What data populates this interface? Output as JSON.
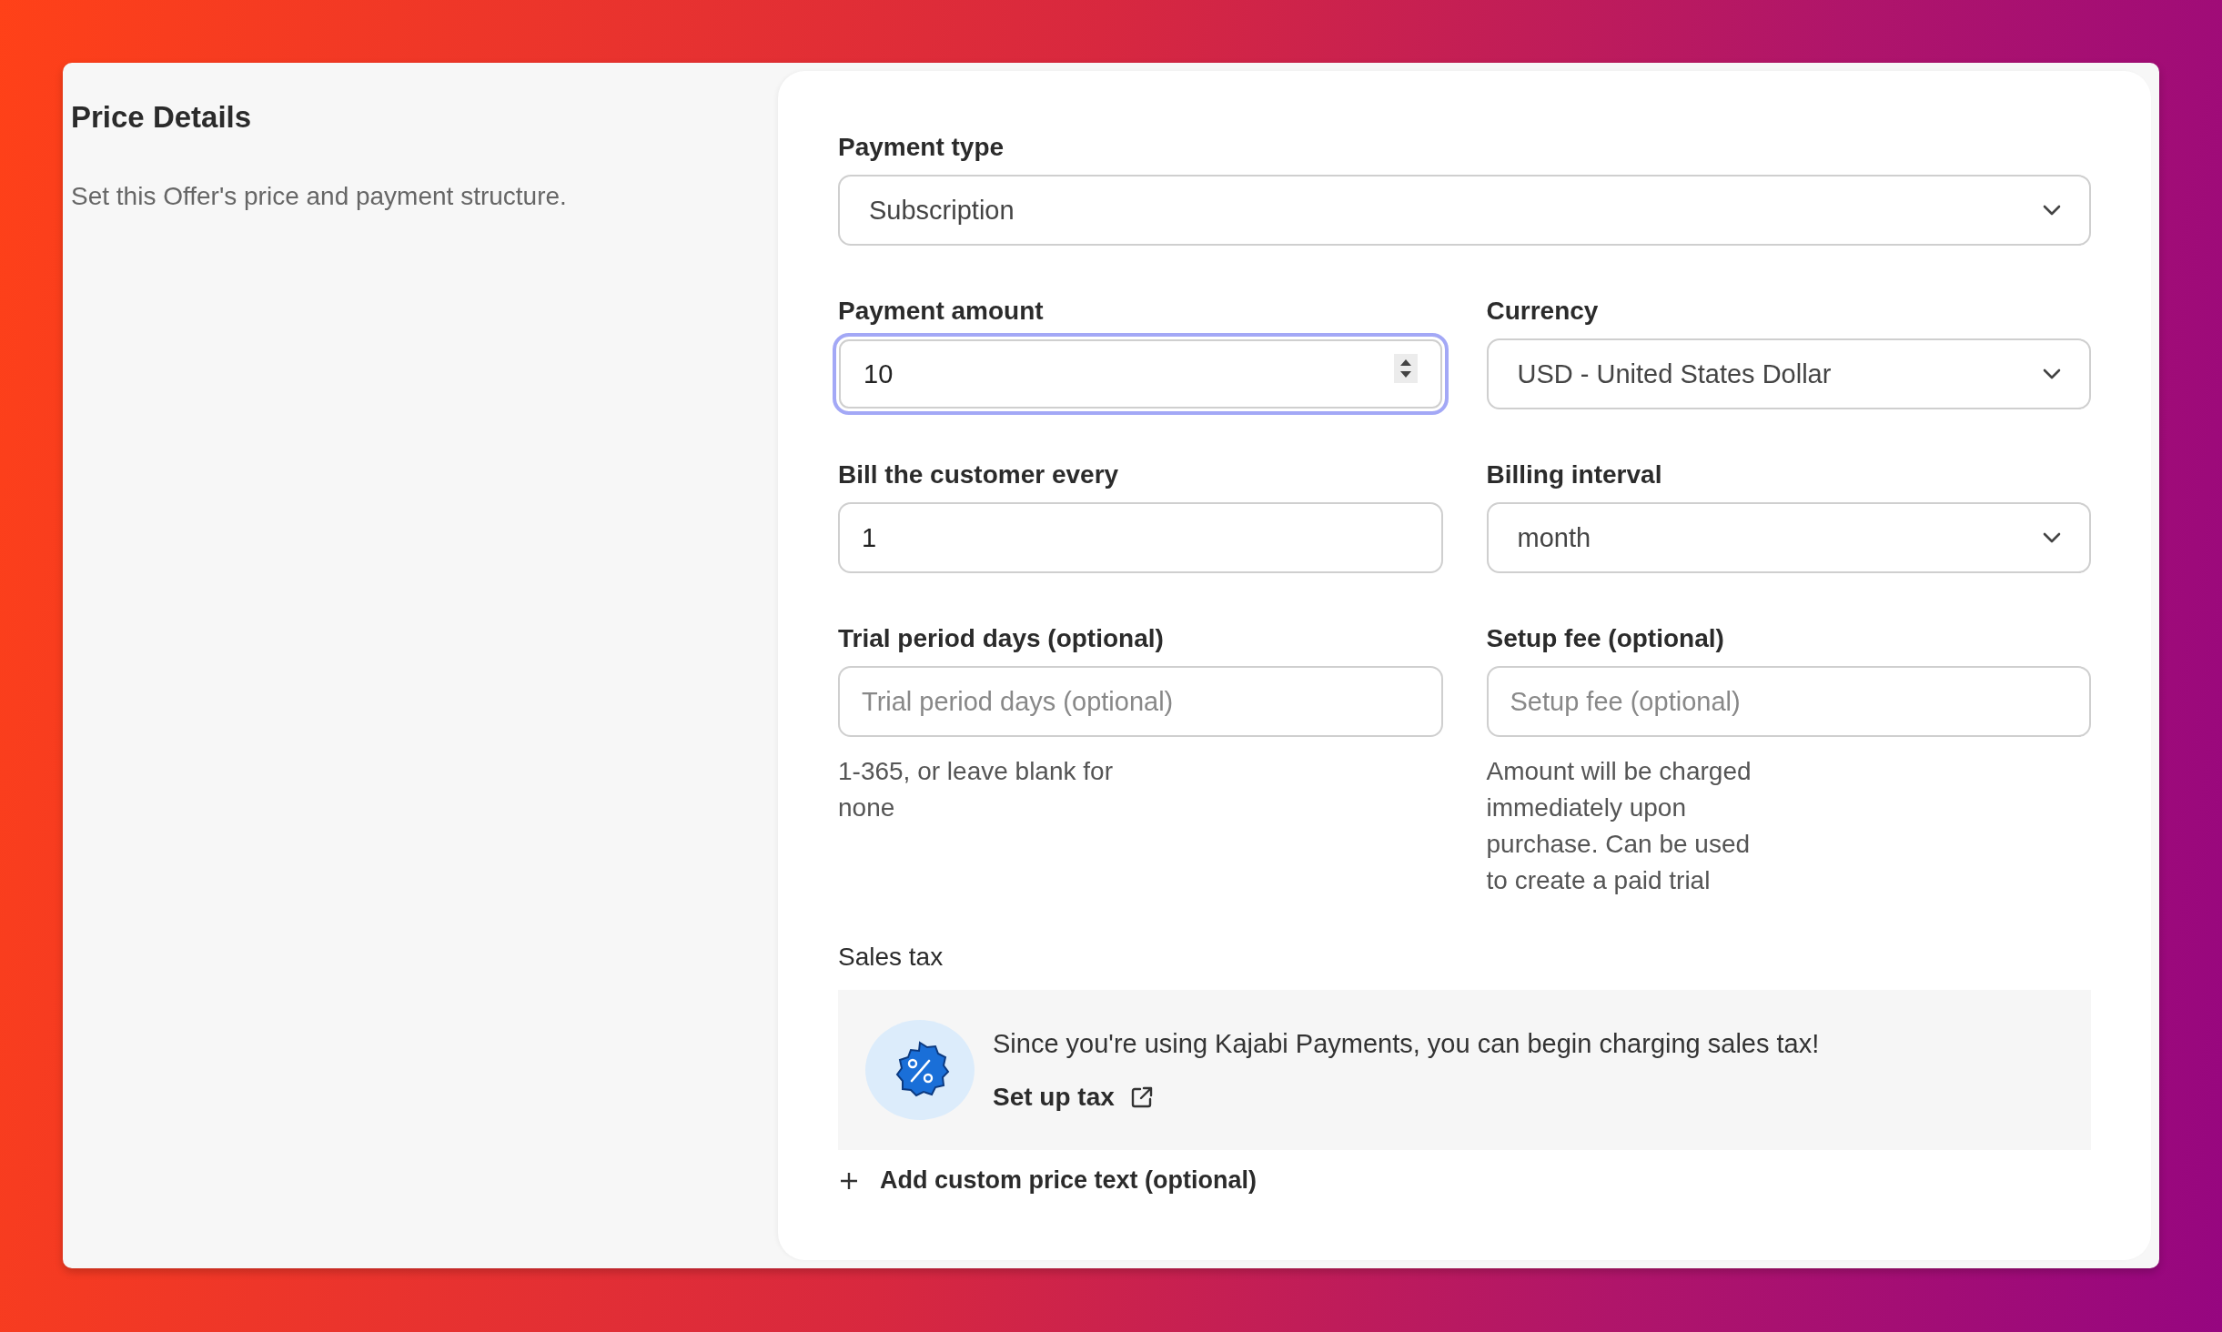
{
  "section": {
    "title": "Price Details",
    "description": "Set this Offer's price and payment structure."
  },
  "rows": [
    [
      {
        "label": "Payment type",
        "kind": "select",
        "value": "Subscription",
        "focused": false
      }
    ],
    [
      {
        "label": "Payment amount",
        "kind": "number",
        "value": "10",
        "focused": true
      },
      {
        "label": "Currency",
        "kind": "select",
        "value": "USD - United States Dollar",
        "focused": false
      }
    ],
    [
      {
        "label": "Bill the customer every",
        "kind": "text",
        "value": "1",
        "focused": false
      },
      {
        "label": "Billing interval",
        "kind": "select",
        "value": "month",
        "focused": false
      }
    ],
    [
      {
        "label": "Trial period days (optional)",
        "kind": "text",
        "placeholder": "Trial period days (optional)",
        "hint": "1-365, or leave blank for none",
        "focused": false
      },
      {
        "label": "Setup fee (optional)",
        "kind": "text",
        "placeholder": "Setup fee (optional)",
        "hint": "Amount will be charged immediately upon purchase. Can be used to create a paid trial",
        "focused": false
      }
    ]
  ],
  "sales_tax": {
    "label": "Sales tax",
    "message": "Since you're using Kajabi Payments, you can begin charging sales tax!",
    "link": "Set up tax"
  },
  "add_custom_text": "Add custom price text (optional)"
}
